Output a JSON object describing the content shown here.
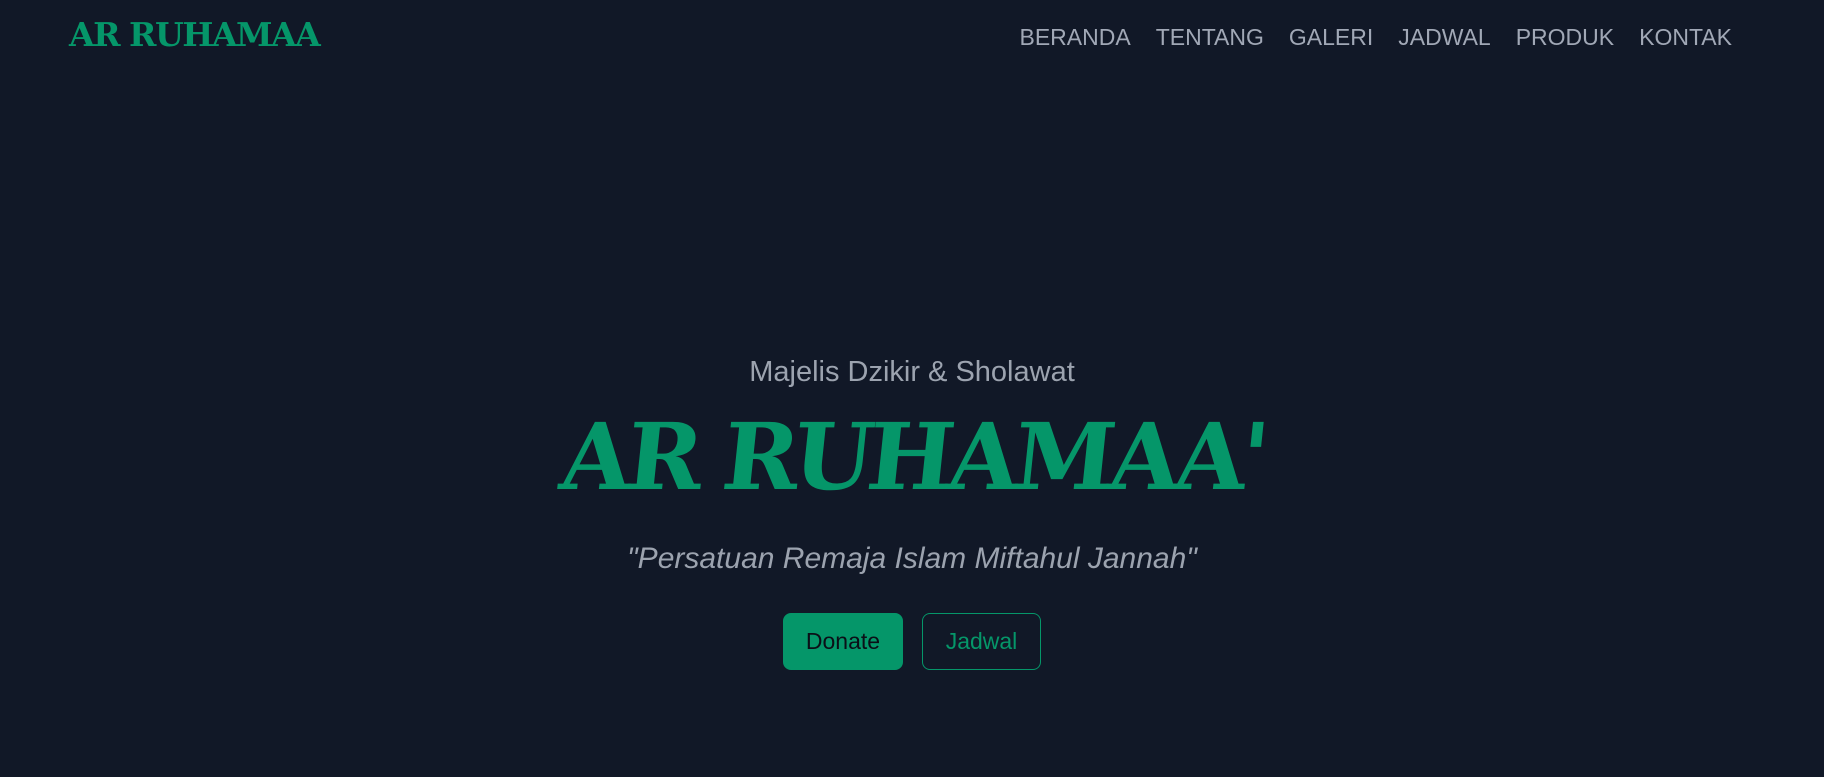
{
  "colors": {
    "background": "#111827",
    "accent": "#059669",
    "muted_text": "#9ca3af"
  },
  "nav": {
    "logo": "AR RUHAMAA",
    "links": [
      "BERANDA",
      "TENTANG",
      "GALERI",
      "JADWAL",
      "PRODUK",
      "KONTAK"
    ]
  },
  "hero": {
    "subtitle": "Majelis Dzikir & Sholawat",
    "title": "AR RUHAMAA'",
    "tagline": "\"Persatuan Remaja Islam Miftahul Jannah\"",
    "buttons": {
      "donate_label": "Donate",
      "jadwal_label": "Jadwal"
    }
  }
}
